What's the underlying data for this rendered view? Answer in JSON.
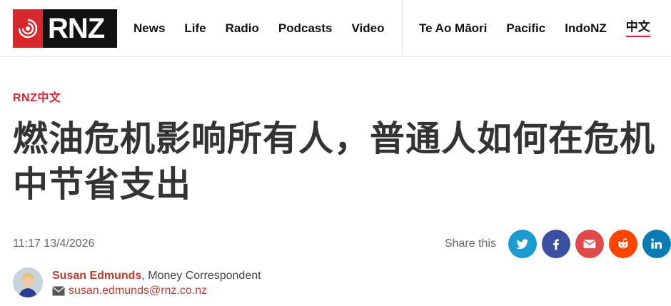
{
  "header": {
    "logo_text": "RNZ",
    "nav_main": [
      "News",
      "Life",
      "Radio",
      "Podcasts",
      "Video"
    ],
    "nav_secondary": [
      "Te Ao Māori",
      "Pacific",
      "IndoNZ",
      "中文"
    ],
    "active_nav": "中文"
  },
  "article": {
    "section": "RNZ中文",
    "title": "燃油危机影响所有人，普通人如何在危机中节省支出",
    "timestamp": "11:17 13/4/2026",
    "share_label": "Share this",
    "share_buttons": [
      "twitter-icon",
      "facebook-icon",
      "email-icon",
      "reddit-icon",
      "linkedin-icon"
    ],
    "author": {
      "name": "Susan Edmunds",
      "role": ", Money Correspondent",
      "email": "susan.edmunds@rnz.co.nz"
    }
  },
  "colors": {
    "accent": "#d7282f",
    "twitter": "#1d9bd1",
    "facebook": "#3b4fa0",
    "email": "#e14a4a",
    "reddit": "#ff4500",
    "linkedin": "#0a7bb3"
  }
}
